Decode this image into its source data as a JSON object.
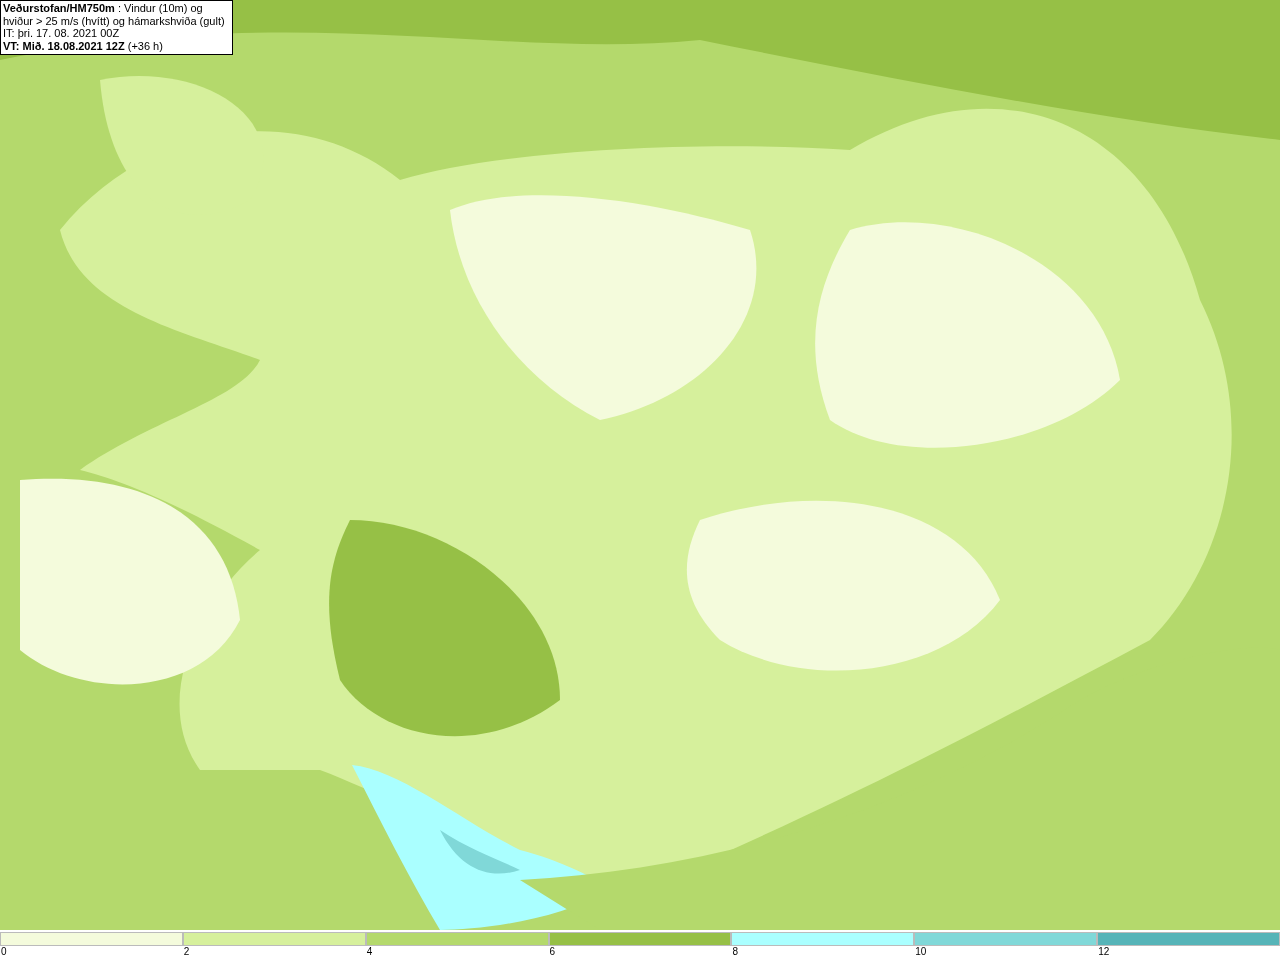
{
  "title_box": {
    "lines": [
      "**Veðurstofan/HM750m** : Vindur (10m) og",
      "hviður > 25 m/s (hvítt) og hámarkshviða (gult)",
      "IT: þri. 17. 08. 2021 00Z",
      "**VT: Mið. 18.08.2021 12Z** (+36 h)"
    ]
  },
  "legend": {
    "bins": [
      {
        "label": "0",
        "color": "#f4fbdc"
      },
      {
        "label": "2",
        "color": "#d6f09c"
      },
      {
        "label": "4",
        "color": "#b4d96c"
      },
      {
        "label": "6",
        "color": "#96c046"
      },
      {
        "label": "8",
        "color": "#aaffff"
      },
      {
        "label": "10",
        "color": "#80d8d8"
      },
      {
        "label": "12",
        "color": "#56b4b8"
      }
    ]
  }
}
